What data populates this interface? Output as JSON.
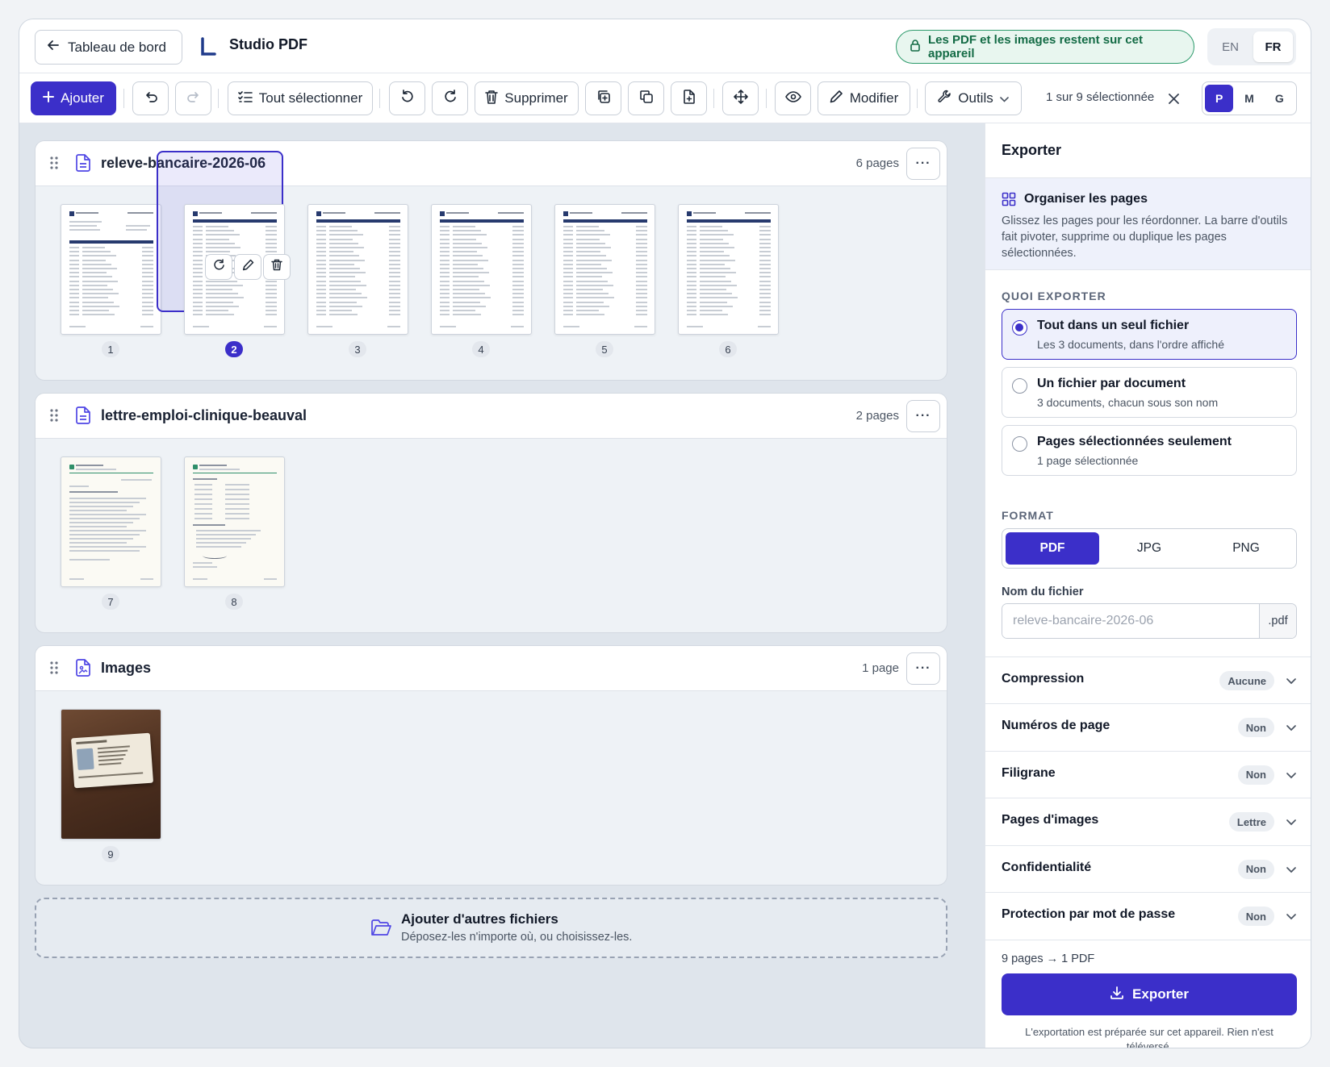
{
  "header": {
    "back_label": "Tableau de bord",
    "app_title": "Studio PDF",
    "privacy_badge": "Les PDF et les images restent sur cet appareil",
    "languages": [
      "EN",
      "FR"
    ],
    "active_language": "FR"
  },
  "toolbar": {
    "add_label": "Ajouter",
    "select_all_label": "Tout sélectionner",
    "delete_label": "Supprimer",
    "edit_label": "Modifier",
    "tools_label": "Outils",
    "selection_count": "1 sur 9 sélectionnée",
    "sizes": [
      "P",
      "M",
      "G"
    ],
    "active_size": "P"
  },
  "documents": [
    {
      "name": "releve-bancaire-2026-06",
      "count": "6 pages",
      "pages": [
        "1",
        "2",
        "3",
        "4",
        "5",
        "6"
      ]
    },
    {
      "name": "lettre-emploi-clinique-beauval",
      "count": "2 pages",
      "pages": [
        "7",
        "8"
      ]
    },
    {
      "name": "Images",
      "count": "1 page",
      "pages": [
        "9"
      ]
    }
  ],
  "selected_page": "2",
  "more_label": "···",
  "dropzone": {
    "title": "Ajouter d'autres fichiers",
    "subtitle": "Déposez-les n'importe où, ou choisissez-les."
  },
  "export": {
    "title": "Exporter",
    "organize_title": "Organiser les pages",
    "organize_text": "Glissez les pages pour les réordonner. La barre d'outils fait pivoter, supprime ou duplique les pages sélectionnées.",
    "what_label": "QUOI EXPORTER",
    "options": [
      {
        "title": "Tout dans un seul fichier",
        "subtitle": "Les 3 documents, dans l'ordre affiché",
        "selected": true
      },
      {
        "title": "Un fichier par document",
        "subtitle": "3 documents, chacun sous son nom",
        "selected": false
      },
      {
        "title": "Pages sélectionnées seulement",
        "subtitle": "1 page sélectionnée",
        "selected": false
      }
    ],
    "format_label": "FORMAT",
    "formats": [
      "PDF",
      "JPG",
      "PNG"
    ],
    "active_format": "PDF",
    "filename_label": "Nom du fichier",
    "filename_placeholder": "releve-bancaire-2026-06",
    "filename_ext": ".pdf",
    "accordions": [
      {
        "title": "Compression",
        "badge": "Aucune"
      },
      {
        "title": "Numéros de page",
        "badge": "Non"
      },
      {
        "title": "Filigrane",
        "badge": "Non"
      },
      {
        "title": "Pages d'images",
        "badge": "Lettre"
      },
      {
        "title": "Confidentialité",
        "badge": "Non"
      },
      {
        "title": "Protection par mot de passe",
        "badge": "Non"
      }
    ],
    "summary": "9 pages → 1 PDF",
    "export_button": "Exporter",
    "foot_note": "L'exportation est préparée sur cet appareil. Rien n'est téléversé."
  },
  "colors": {
    "accent": "#3b2fc9",
    "privacy_green": "#2c9a6b",
    "bank_header": "#273a6e",
    "clinic_green": "#2f8f6a"
  }
}
